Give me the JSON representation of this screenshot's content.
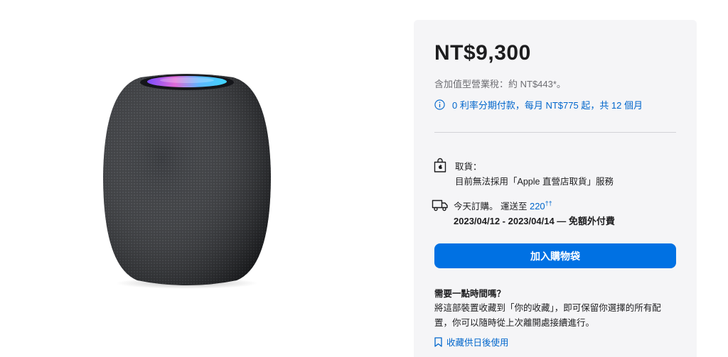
{
  "product": {
    "price": "NT$9,300",
    "vat_note": "含加值型營業稅：約 NT$443*。",
    "installment": "0 利率分期付款，每月 NT$775 起，共 12 個月"
  },
  "pickup": {
    "label": "取貨：",
    "status": "目前無法採用「Apple 直營店取貨」服務"
  },
  "shipping": {
    "prefix": "今天訂購。 運送至",
    "zip": "220",
    "zip_sup": "††",
    "dates": "2023/04/12 - 2023/04/14 — 免額外付費"
  },
  "cart": {
    "add_label": "加入購物袋"
  },
  "save": {
    "title": "需要一點時間嗎？",
    "description": "將這部裝置收藏到「你的收藏」，即可保留你選擇的所有配置，你可以隨時從上次離開處接續進行。",
    "link": "收藏供日後使用"
  },
  "icons": {
    "info": "info-circle-icon",
    "pickup": "shopping-bag-apple-icon",
    "shipping": "delivery-truck-icon",
    "save": "bookmark-icon"
  },
  "colors": {
    "accent": "#0071e3",
    "link": "#0066cc",
    "panel": "#f5f5f7"
  }
}
